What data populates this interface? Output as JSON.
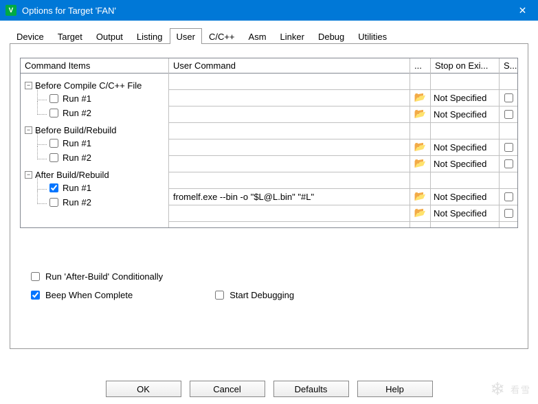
{
  "window": {
    "title": "Options for Target 'FAN'"
  },
  "tabs": [
    "Device",
    "Target",
    "Output",
    "Listing",
    "User",
    "C/C++",
    "Asm",
    "Linker",
    "Debug",
    "Utilities"
  ],
  "activeTab": 4,
  "grid": {
    "headers": {
      "tree": "Command Items",
      "cmd": "User Command",
      "browse": "...",
      "stop": "Stop on Exi...",
      "spawn": "S..."
    },
    "groups": [
      {
        "label": "Before Compile C/C++ File",
        "items": [
          {
            "label": "Run #1",
            "checked": false,
            "cmd": "",
            "stop": "Not Specified"
          },
          {
            "label": "Run #2",
            "checked": false,
            "cmd": "",
            "stop": "Not Specified"
          }
        ]
      },
      {
        "label": "Before Build/Rebuild",
        "items": [
          {
            "label": "Run #1",
            "checked": false,
            "cmd": "",
            "stop": "Not Specified"
          },
          {
            "label": "Run #2",
            "checked": false,
            "cmd": "",
            "stop": "Not Specified"
          }
        ]
      },
      {
        "label": "After Build/Rebuild",
        "items": [
          {
            "label": "Run #1",
            "checked": true,
            "cmd": "fromelf.exe --bin -o \"$L@L.bin\" \"#L\"",
            "stop": "Not Specified"
          },
          {
            "label": "Run #2",
            "checked": false,
            "cmd": "",
            "stop": "Not Specified"
          }
        ]
      }
    ]
  },
  "options": {
    "conditional": {
      "label": "Run 'After-Build' Conditionally",
      "checked": false
    },
    "beep": {
      "label": "Beep When Complete",
      "checked": true
    },
    "debug": {
      "label": "Start Debugging",
      "checked": false
    }
  },
  "buttons": {
    "ok": "OK",
    "cancel": "Cancel",
    "defaults": "Defaults",
    "help": "Help"
  },
  "watermark": "看雪"
}
